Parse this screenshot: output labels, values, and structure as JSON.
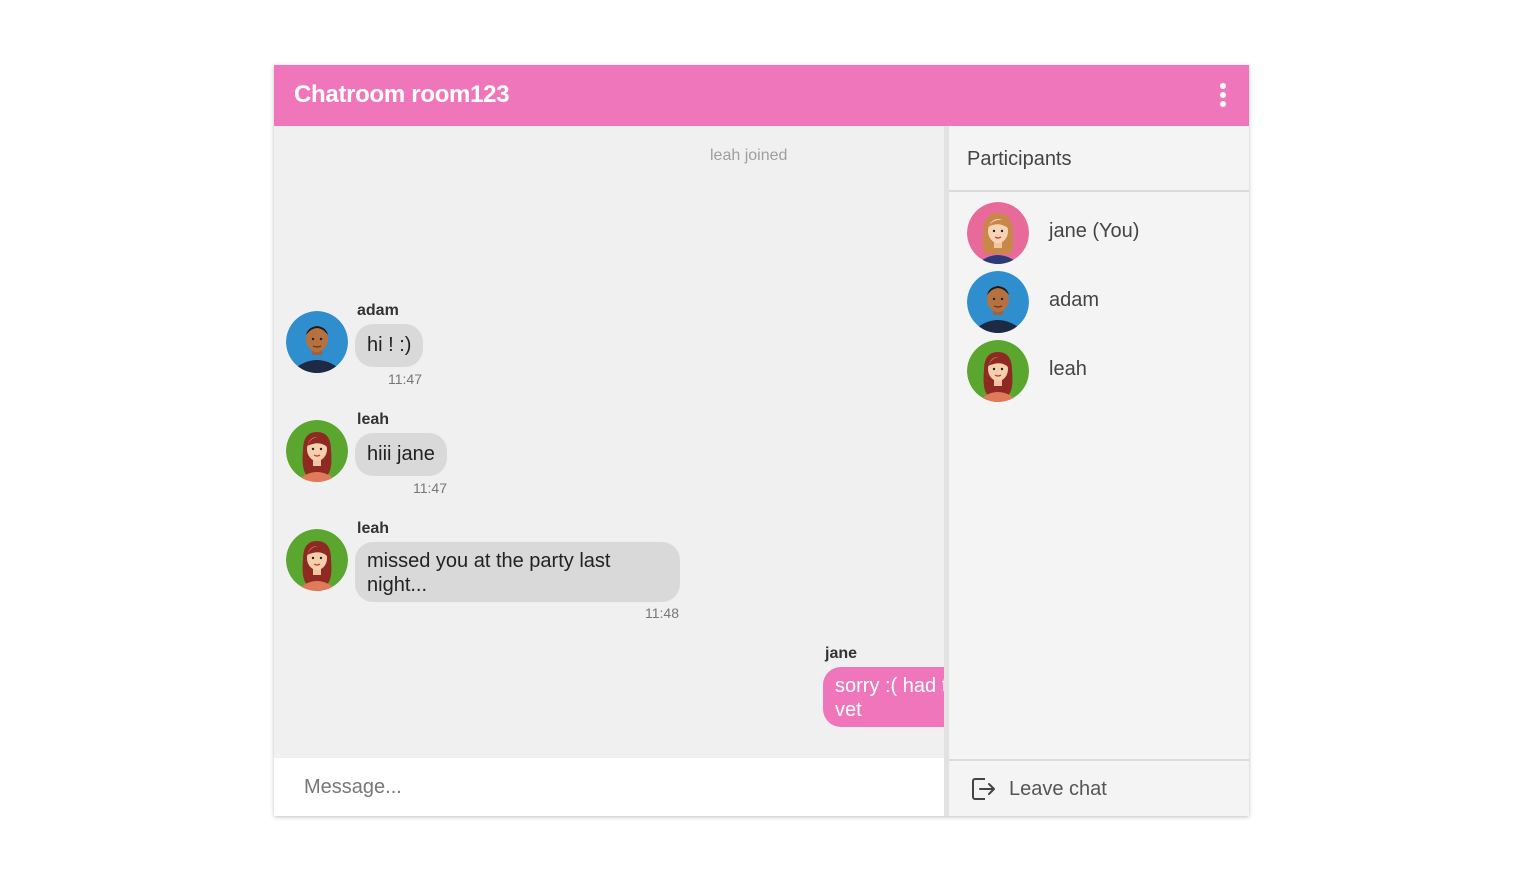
{
  "header": {
    "title": "Chatroom room123",
    "menu_icon": "more-vert-icon",
    "color": "#f076bb"
  },
  "chat": {
    "system_message": "leah joined",
    "messages": [
      {
        "sender": "adam",
        "text": "hi ! :)",
        "time": "11:47"
      },
      {
        "sender": "leah",
        "text": "hiii jane",
        "time": "11:47"
      },
      {
        "sender": "leah",
        "text": "missed you at the party last night...",
        "time": "11:48"
      },
      {
        "sender": "jane",
        "text": "sorry :( had t",
        "text2": "vet",
        "mine": true
      }
    ]
  },
  "composer": {
    "placeholder": "Message..."
  },
  "sidebar": {
    "title": "Participants",
    "participants": [
      {
        "name": "jane (You)",
        "avatar_color": "#e86a9a"
      },
      {
        "name": "adam",
        "avatar_color": "#2f8fce"
      },
      {
        "name": "leah",
        "avatar_color": "#5aa62e"
      }
    ],
    "leave_label": "Leave chat",
    "leave_icon": "exit-icon"
  }
}
